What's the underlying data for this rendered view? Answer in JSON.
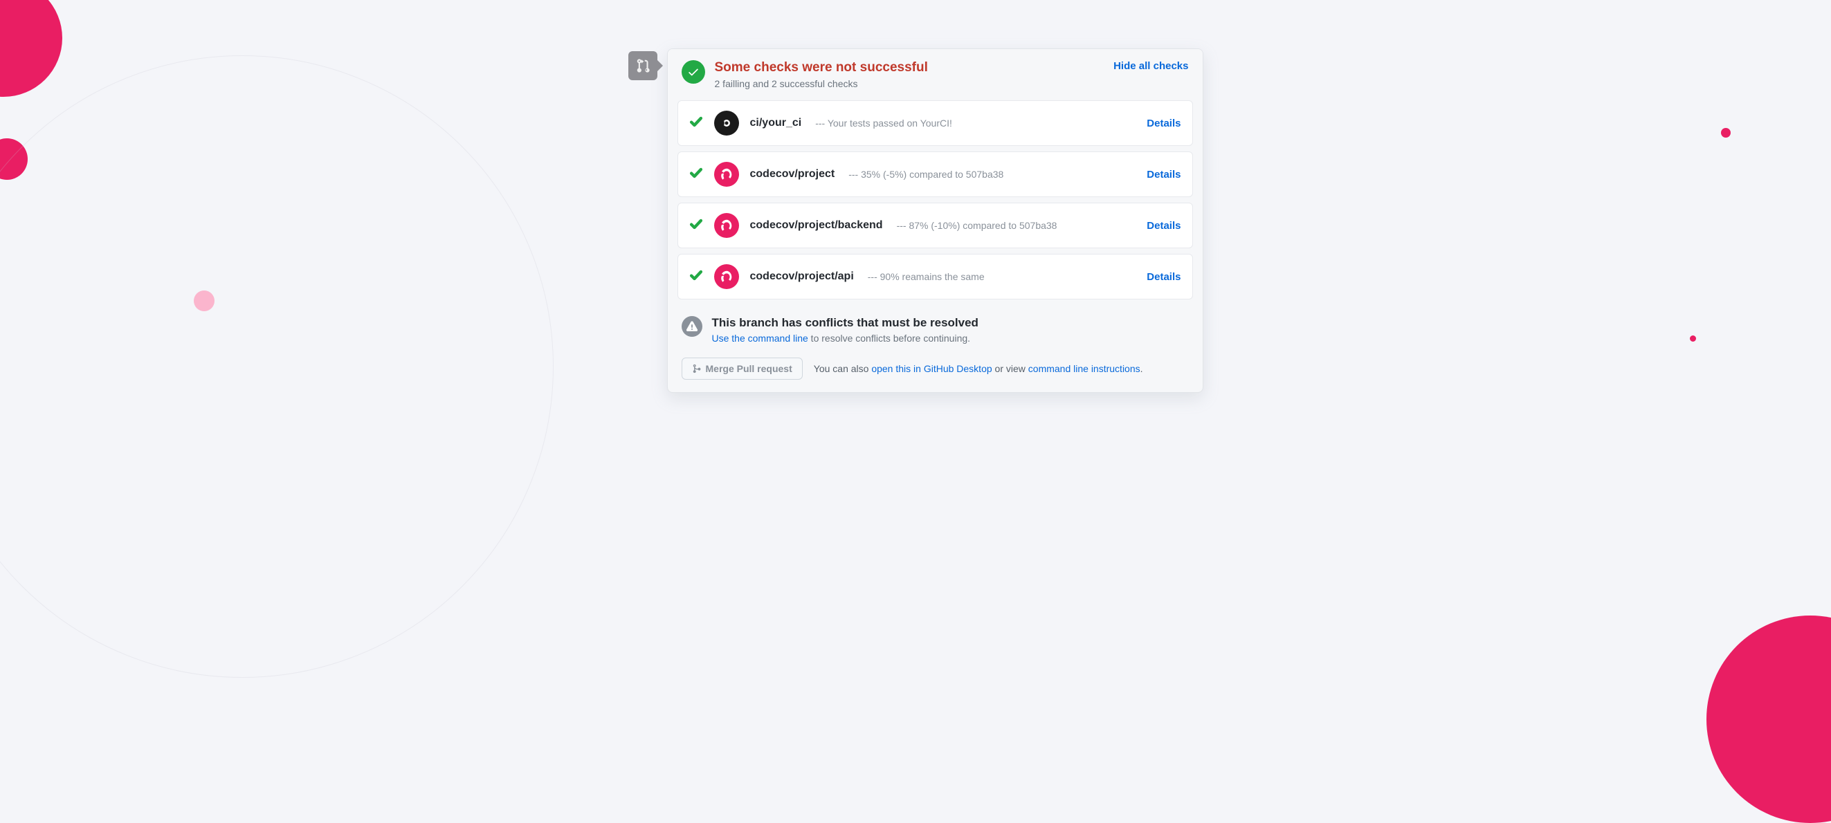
{
  "header": {
    "title": "Some checks were not successful",
    "subtitle": "2 failling and 2 successful checks",
    "hide_link": "Hide all checks"
  },
  "checks": [
    {
      "icon_type": "ci",
      "name": "ci/your_ci",
      "desc": "--- Your tests passed on YourCI!",
      "details": "Details"
    },
    {
      "icon_type": "cov",
      "name": "codecov/project",
      "desc": "--- 35% (-5%) compared to 507ba38",
      "details": "Details"
    },
    {
      "icon_type": "cov",
      "name": "codecov/project/backend",
      "desc": "--- 87% (-10%) compared to 507ba38",
      "details": "Details"
    },
    {
      "icon_type": "cov",
      "name": "codecov/project/api",
      "desc": "--- 90% reamains the same",
      "details": "Details"
    }
  ],
  "conflict": {
    "title": "This branch has conflicts that must be resolved",
    "link": "Use the command line",
    "rest": " to resolve conflicts before continuing."
  },
  "footer": {
    "merge_button": "Merge Pull request",
    "prefix": "You can also ",
    "link1": "open this in GitHub Desktop",
    "mid": " or view ",
    "link2": "command line instructions",
    "suffix": "."
  }
}
